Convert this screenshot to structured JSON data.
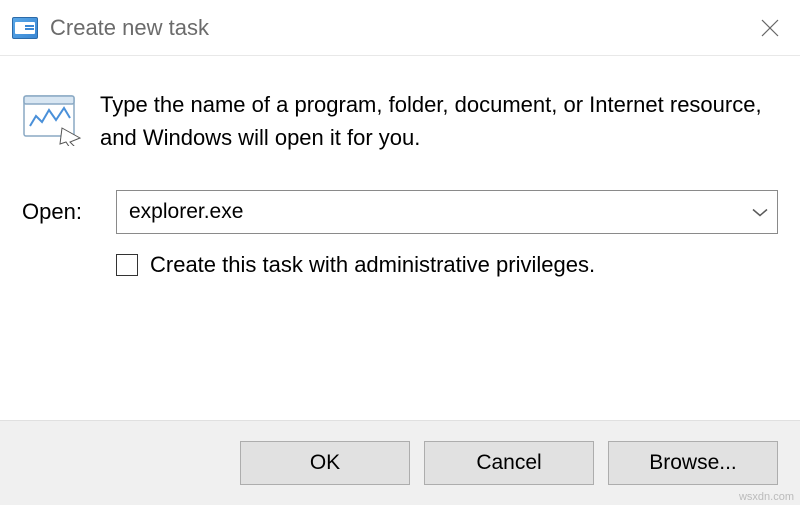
{
  "titlebar": {
    "title": "Create new task"
  },
  "content": {
    "info_text": "Type the name of a program, folder, document, or Internet resource, and Windows will open it for you.",
    "open_label": "Open:",
    "open_value": "explorer.exe",
    "admin_checkbox_label": "Create this task with administrative privileges."
  },
  "buttons": {
    "ok": "OK",
    "cancel": "Cancel",
    "browse": "Browse..."
  },
  "watermark": "wsxdn.com"
}
